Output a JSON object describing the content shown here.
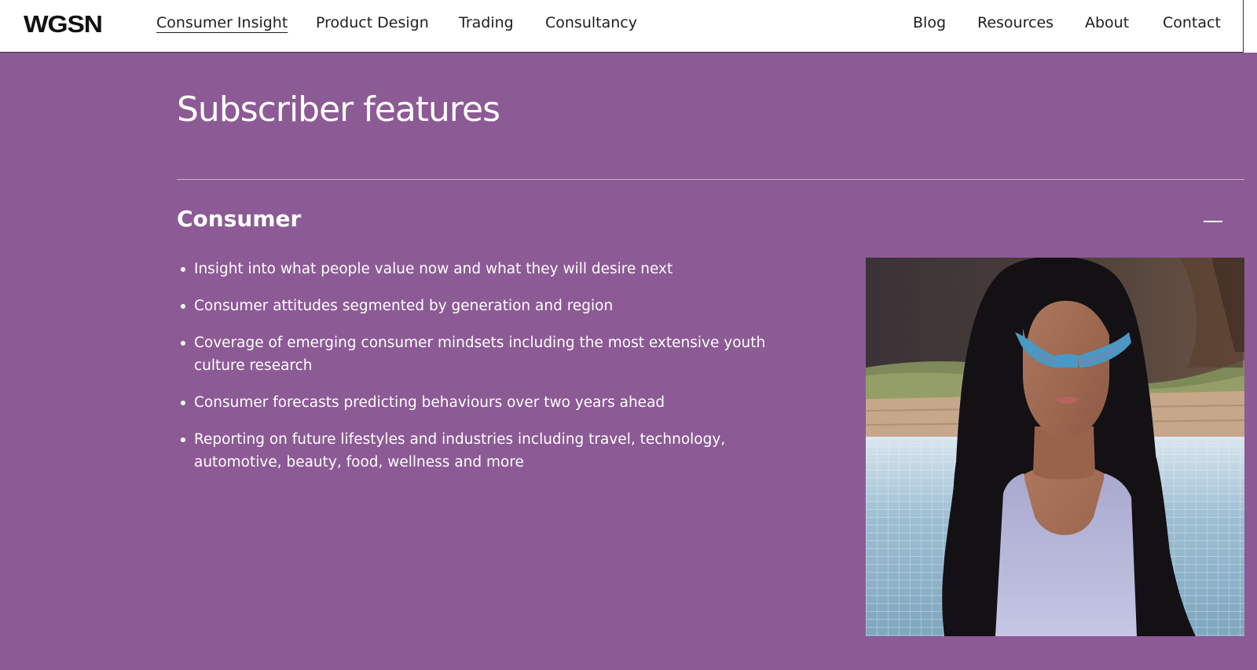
{
  "brand": {
    "logo_text": "WGSN"
  },
  "nav": {
    "primary": [
      {
        "label": "Consumer Insight",
        "active": true
      },
      {
        "label": "Product Design",
        "active": false
      },
      {
        "label": "Trading",
        "active": false
      },
      {
        "label": "Consultancy",
        "active": false
      }
    ],
    "secondary": [
      {
        "label": "Blog"
      },
      {
        "label": "Resources"
      },
      {
        "label": "About"
      },
      {
        "label": "Contact"
      }
    ]
  },
  "page": {
    "title": "Subscriber features",
    "background_color": "#8c5a95"
  },
  "accordion": {
    "heading": "Consumer",
    "expanded": true,
    "toggle_icon": "minus-icon",
    "items": [
      "Insight into what people value now and what they will desire next",
      "Consumer attitudes segmented by generation and region",
      "Coverage of emerging consumer mindsets including the most extensive youth culture research",
      "Consumer forecasts predicting behaviours over two years ahead",
      "Reporting on future lifestyles and industries including travel, technology, automotive, beauty, food, wellness and more"
    ]
  }
}
